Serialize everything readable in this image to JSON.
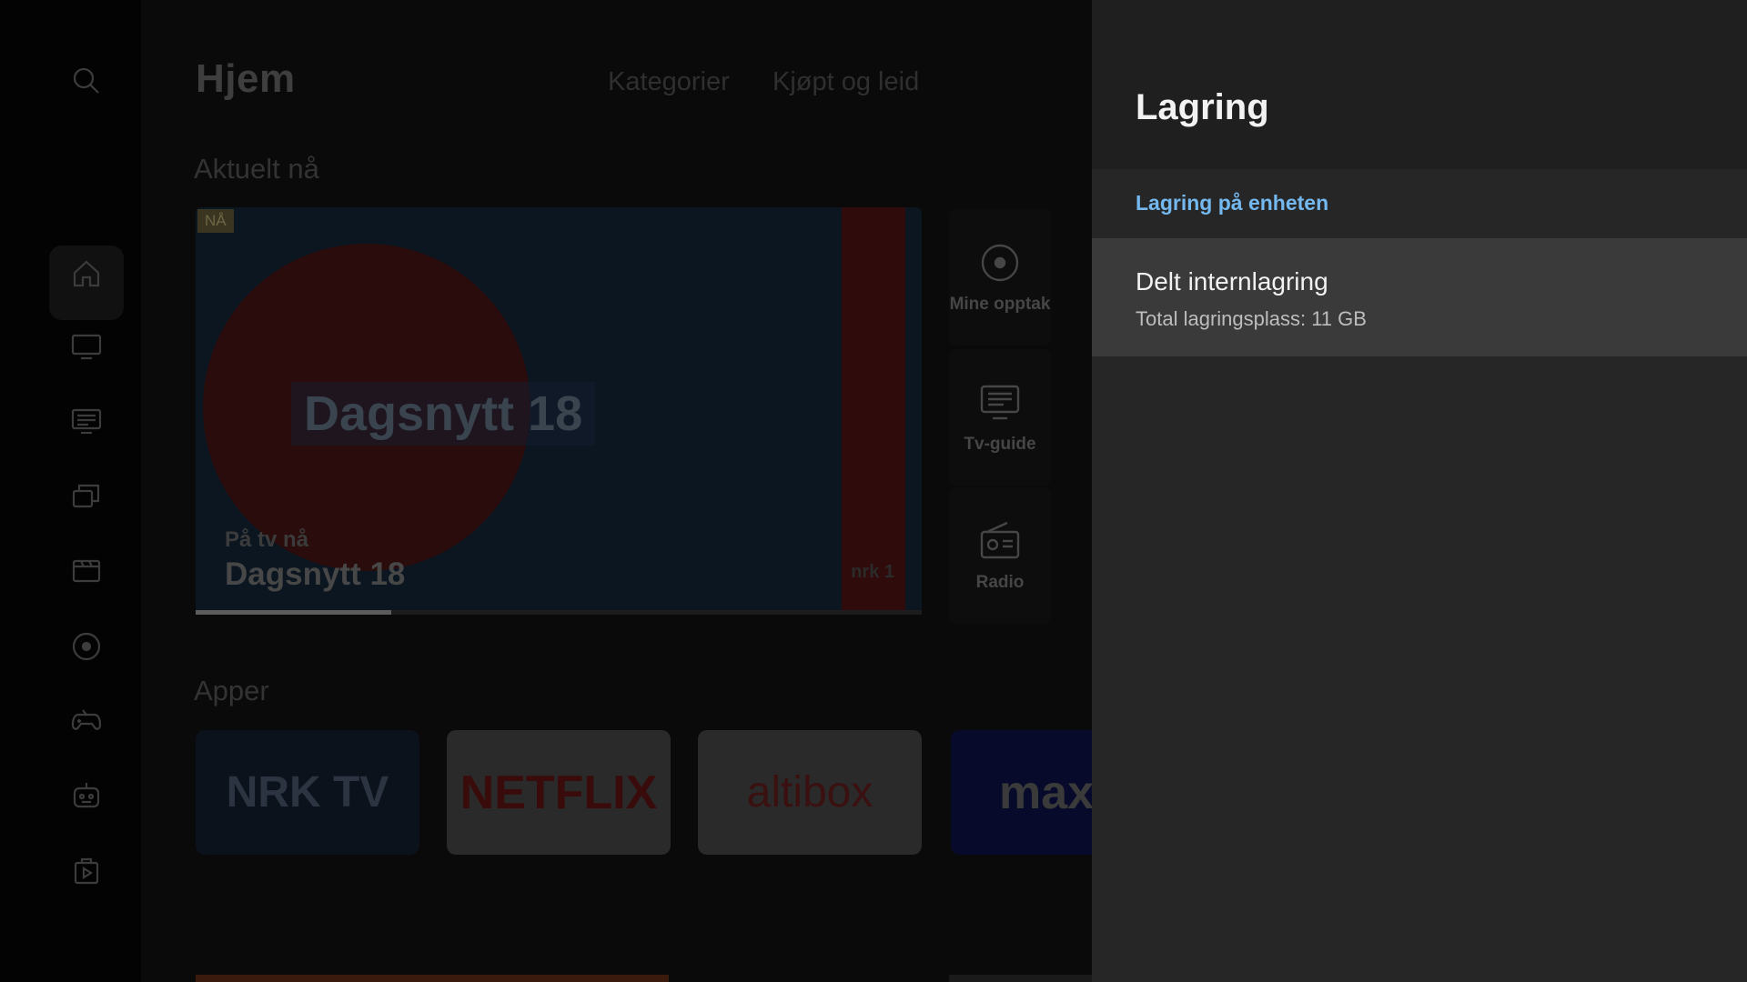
{
  "home": {
    "title": "Hjem",
    "tabs": [
      "Kategorier",
      "Kjøpt og leid"
    ],
    "section_current": "Aktuelt nå",
    "hero": {
      "badge": "NÅ",
      "overlay_title": "Dagsnytt 18",
      "subtitle": "På tv nå",
      "name": "Dagsnytt 18",
      "channel_logo": "nrk 1",
      "progress": 0.27
    },
    "shortcuts": [
      {
        "label": "Mine opptak",
        "icon": "record-icon"
      },
      {
        "label": "Tv-guide",
        "icon": "tv-guide-icon"
      },
      {
        "label": "Radio",
        "icon": "radio-icon"
      }
    ],
    "section_apps": "Apper",
    "apps": [
      {
        "label": "NRK TV",
        "icon": "nrk-tv-logo"
      },
      {
        "label": "NETFLIX",
        "icon": "netflix-logo"
      },
      {
        "label": "altibox",
        "icon": "altibox-logo"
      },
      {
        "label": "max",
        "icon": "max-logo"
      }
    ],
    "rail_icons": [
      "search-icon",
      "home-icon",
      "tv-icon",
      "guide-icon",
      "library-icon",
      "movie-icon",
      "record-icon",
      "games-icon",
      "kids-icon",
      "play-store-icon"
    ]
  },
  "panel": {
    "title": "Lagring",
    "section_label": "Lagring på enheten",
    "item": {
      "title": "Delt internlagring",
      "subtitle": "Total lagringsplass: 11 GB"
    }
  },
  "colors": {
    "panel_bg": "#262626",
    "panel_header_bg": "#1f1f1f",
    "selected_item_bg": "#3a3a3a",
    "accent_blue": "#74b8f0"
  }
}
